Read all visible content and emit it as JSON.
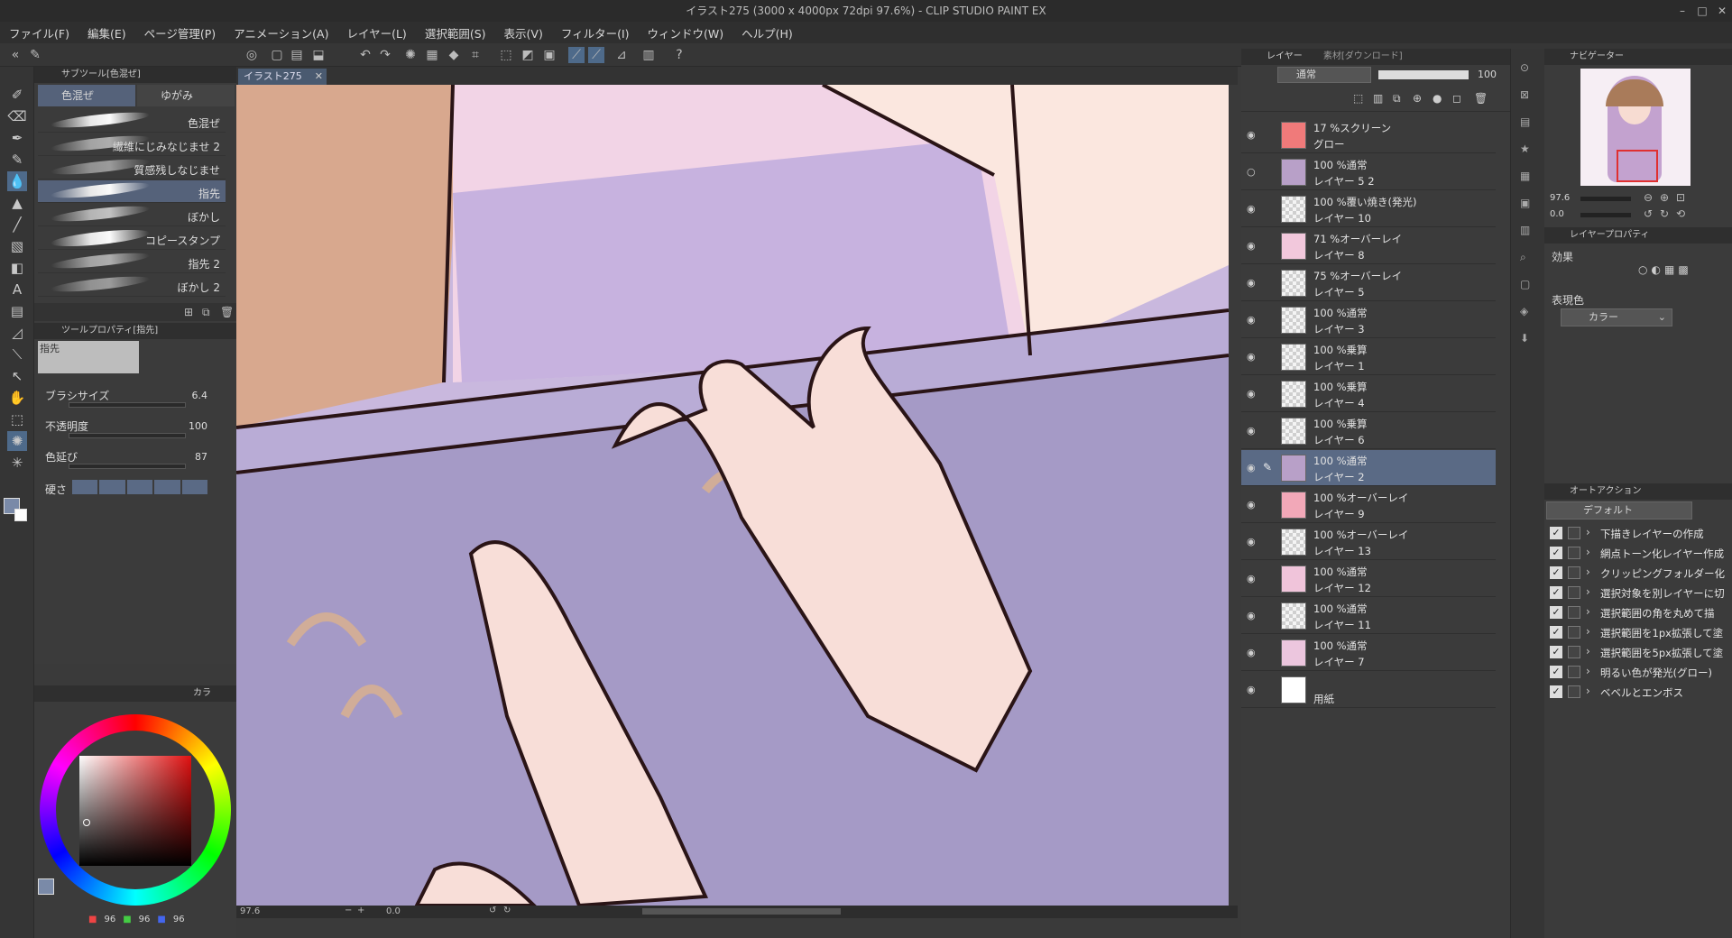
{
  "window": {
    "title": "イラスト275 (3000 x 4000px 72dpi 97.6%) - CLIP STUDIO PAINT EX"
  },
  "menu": [
    "ファイル(F)",
    "編集(E)",
    "ページ管理(P)",
    "アニメーション(A)",
    "レイヤー(L)",
    "選択範囲(S)",
    "表示(V)",
    "フィルター(I)",
    "ウィンドウ(W)",
    "ヘルプ(H)"
  ],
  "subtool": {
    "header": "サブツール[色混ぜ]",
    "tabs": [
      "色混ぜ",
      "ゆがみ"
    ],
    "brushes": [
      "色混ぜ",
      "繊維にじみなじませ 2",
      "質感残しなじませ",
      "指先",
      "ぼかし",
      "コピースタンプ",
      "指先 2",
      "ぼかし 2"
    ],
    "selected": "指先"
  },
  "toolprop": {
    "header": "ツールプロパティ[指先]",
    "preview_label": "指先",
    "brush_size_label": "ブラシサイズ",
    "brush_size": "6.4",
    "opacity_label": "不透明度",
    "opacity": "100",
    "color_stretch_label": "色延び",
    "color_stretch": "87",
    "hardness_label": "硬さ"
  },
  "color": {
    "tab": "カラ",
    "r": "96",
    "g": "96",
    "b": "96"
  },
  "canvas": {
    "tab": "イラスト275",
    "zoom": "97.6",
    "angle": "0.0"
  },
  "layers": {
    "tabs": [
      "レイヤー",
      "素材[ダウンロード]"
    ],
    "blend_mode": "通常",
    "opacity": "100",
    "rows": [
      {
        "mode": "17 %スクリーン",
        "name": "グロー",
        "color": "#f07a7a",
        "selected": false
      },
      {
        "mode": "100 %通常",
        "name": "レイヤー 5 2",
        "color": "#b8a0c8",
        "selected": false
      },
      {
        "mode": "100 %覆い焼き(発光)",
        "name": "レイヤー 10",
        "color": "",
        "selected": false
      },
      {
        "mode": "71 %オーバーレイ",
        "name": "レイヤー 8",
        "color": "#f2c8dc",
        "selected": false
      },
      {
        "mode": "75 %オーバーレイ",
        "name": "レイヤー 5",
        "color": "",
        "selected": false
      },
      {
        "mode": "100 %通常",
        "name": "レイヤー 3",
        "color": "",
        "selected": false
      },
      {
        "mode": "100 %乗算",
        "name": "レイヤー 1",
        "color": "",
        "selected": false
      },
      {
        "mode": "100 %乗算",
        "name": "レイヤー 4",
        "color": "",
        "selected": false
      },
      {
        "mode": "100 %乗算",
        "name": "レイヤー 6",
        "color": "",
        "selected": false
      },
      {
        "mode": "100 %通常",
        "name": "レイヤー 2",
        "color": "#b8a0c8",
        "selected": true
      },
      {
        "mode": "100 %オーバーレイ",
        "name": "レイヤー 9",
        "color": "#f2a8b8",
        "selected": false
      },
      {
        "mode": "100 %オーバーレイ",
        "name": "レイヤー 13",
        "color": "",
        "selected": false
      },
      {
        "mode": "100 %通常",
        "name": "レイヤー 12",
        "color": "#f0c4da",
        "selected": false
      },
      {
        "mode": "100 %通常",
        "name": "レイヤー 11",
        "color": "",
        "selected": false
      },
      {
        "mode": "100 %通常",
        "name": "レイヤー 7",
        "color": "#ecc6de",
        "selected": false
      },
      {
        "mode": "",
        "name": "用紙",
        "color": "#ffffff",
        "selected": false
      }
    ]
  },
  "navigator": {
    "header": "ナビゲーター",
    "zoom": "97.6",
    "angle": "0.0"
  },
  "layer_property": {
    "header": "レイヤープロパティ",
    "effect_label": "効果",
    "expression_label": "表現色",
    "expression_value": "カラー"
  },
  "auto_action": {
    "header": "オートアクション",
    "set": "デフォルト",
    "items": [
      "下描きレイヤーの作成",
      "網点トーン化レイヤー作成",
      "クリッピングフォルダー化",
      "選択対象を別レイヤーに切",
      "選択範囲の角を丸めて描",
      "選択範囲を1px拡張して塗",
      "選択範囲を5px拡張して塗",
      "明るい色が発光(グロー)",
      "ベベルとエンボス"
    ]
  }
}
